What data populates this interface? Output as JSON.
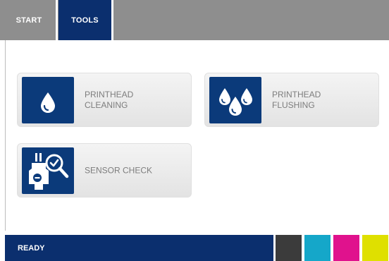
{
  "tabs": [
    {
      "label": "START",
      "active": false
    },
    {
      "label": "TOOLS",
      "active": true
    }
  ],
  "tools": [
    {
      "label": "PRINTHEAD\nCLEANING",
      "icon": "single-drop-icon"
    },
    {
      "label": "PRINTHEAD\nFLUSHING",
      "icon": "multi-drop-icon"
    },
    {
      "label": "SENSOR CHECK",
      "icon": "sensor-magnifier-icon"
    }
  ],
  "status": {
    "text": "READY"
  },
  "colors": {
    "topbar": "#8e8e8e",
    "active_tab": "#0b2f6e",
    "icon_bg": "#0b3a7a",
    "statusbar": "#0b2f6e",
    "ink_black": "#3b3b3b",
    "ink_cyan": "#15a7c9",
    "ink_magenta": "#e0128d",
    "ink_yellow": "#dfe000"
  }
}
